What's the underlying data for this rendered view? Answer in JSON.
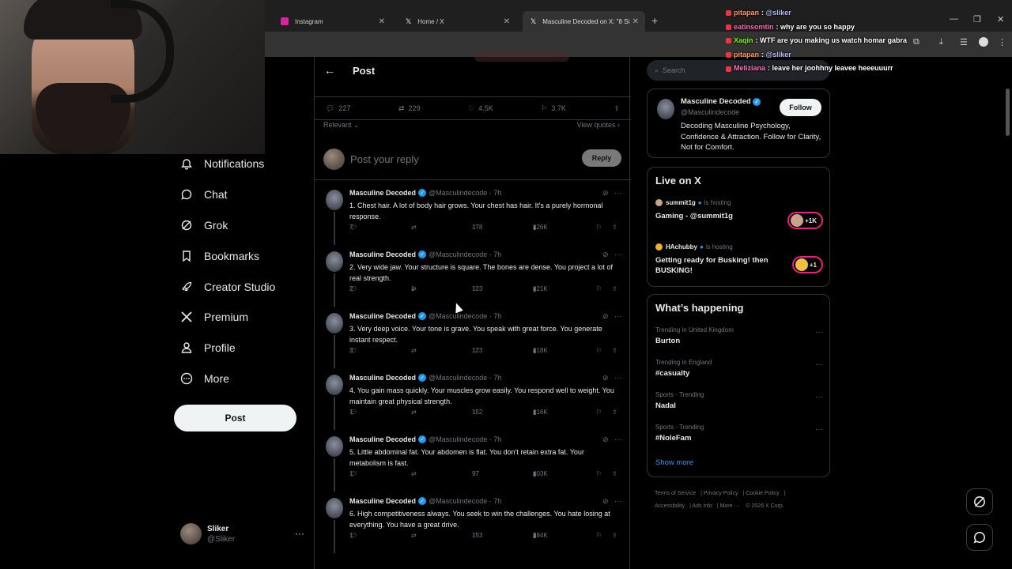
{
  "browser": {
    "tabs": [
      {
        "label": "Instagram",
        "color": "#d6249f"
      },
      {
        "label": "Home / X",
        "color": "#ffffff"
      },
      {
        "label": "Masculine Decoded on X: \"8 Si",
        "color": "#ffffff"
      }
    ]
  },
  "nav": {
    "items": [
      {
        "label": "Notifications",
        "icon": "bell-icon"
      },
      {
        "label": "Chat",
        "icon": "chat-icon"
      },
      {
        "label": "Grok",
        "icon": "grok-icon"
      },
      {
        "label": "Bookmarks",
        "icon": "bookmark-icon"
      },
      {
        "label": "Creator Studio",
        "icon": "rocket-icon"
      },
      {
        "label": "Premium",
        "icon": "x-logo-icon"
      },
      {
        "label": "Profile",
        "icon": "person-icon"
      },
      {
        "label": "More",
        "icon": "more-circle-icon"
      }
    ],
    "post_label": "Post",
    "user": {
      "name": "Sliker",
      "handle": "@Sliker"
    }
  },
  "main": {
    "title": "Post",
    "stats": {
      "replies": "227",
      "reposts": "229",
      "likes": "4.5K",
      "bookmarks": "3.7K"
    },
    "sort_label": "Relevant",
    "view_quotes": "View quotes",
    "reply_placeholder": "Post your reply",
    "reply_button": "Reply",
    "replies": [
      {
        "name": "Masculine Decoded",
        "handle": "@Masculindecode",
        "time": "7h",
        "text": "1. Chest hair. A lot of body hair grows. Your chest has hair. It's a purely hormonal response.",
        "replies": "7",
        "reposts": "",
        "likes": "178",
        "views": "426K"
      },
      {
        "name": "Masculine Decoded",
        "handle": "@Masculindecode",
        "time": "7h",
        "text": "2. Very wide jaw. Your structure is square. The bones are dense. You project a lot of real strength.",
        "replies": "2",
        "reposts": "1",
        "likes": "123",
        "views": "421K"
      },
      {
        "name": "Masculine Decoded",
        "handle": "@Masculindecode",
        "time": "7h",
        "text": "3. Very deep voice. Your tone is grave. You speak with great force. You generate instant respect.",
        "replies": "3",
        "reposts": "",
        "likes": "123",
        "views": "418K"
      },
      {
        "name": "Masculine Decoded",
        "handle": "@Masculindecode",
        "time": "7h",
        "text": "4. You gain mass quickly. Your muscles grow easily. You respond well to weight. You maintain great physical strength.",
        "replies": "1",
        "reposts": "",
        "likes": "152",
        "views": "416K"
      },
      {
        "name": "Masculine Decoded",
        "handle": "@Masculindecode",
        "time": "7h",
        "text": "5. Little abdominal fat. Your abdomen is flat. You don't retain extra fat. Your metabolism is fast.",
        "replies": "1",
        "reposts": "",
        "likes": "97",
        "views": "403K"
      },
      {
        "name": "Masculine Decoded",
        "handle": "@Masculindecode",
        "time": "7h",
        "text": "6. High competitiveness always. You seek to win the challenges. You hate losing at everything. You have a great drive.",
        "replies": "1",
        "reposts": "",
        "likes": "153",
        "views": "384K"
      }
    ]
  },
  "right": {
    "search_placeholder": "Search",
    "promo": {
      "name": "Masculine Decoded",
      "handle": "@Masculindecode",
      "follow": "Follow",
      "bio": "Decoding Masculine Psychology, Confidence & Attraction. Follow for Clarity, Not for Comfort."
    },
    "live": {
      "title": "Live on X",
      "hosting_label": "is hosting",
      "items": [
        {
          "host": "summit1g",
          "title": "Gaming - @summit1g",
          "count": "+1K"
        },
        {
          "host": "HAchubby",
          "title": "Getting ready for Busking! then BUSKING!",
          "count": "+1"
        }
      ]
    },
    "trends": {
      "title": "What’s happening",
      "items": [
        {
          "context": "Trending in United Kingdom",
          "name": "Burton"
        },
        {
          "context": "Trending in England",
          "name": "#casualty"
        },
        {
          "context": "Sports · Trending",
          "name": "Nadal"
        },
        {
          "context": "Sports · Trending",
          "name": "#NoleFam"
        }
      ],
      "show_more": "Show more"
    },
    "footer": [
      "Terms of Service",
      "Privacy Policy",
      "Cookie Policy",
      "Accessibility",
      "Ads info",
      "More ···",
      "© 2026 X Corp."
    ]
  },
  "chat": [
    {
      "user": "pitapan",
      "color": "#ff9a5c",
      "msg": "",
      "mention": "@sliker"
    },
    {
      "user": "eatinsomtin",
      "color": "#ff69b4",
      "msg": "why are you so happy",
      "mention": ""
    },
    {
      "user": "Xaqin",
      "color": "#7cfc00",
      "msg": "WTF are you making us watch homar gabra",
      "mention": ""
    },
    {
      "user": "pitapan",
      "color": "#ff9a5c",
      "msg": "",
      "mention": "@sliker"
    },
    {
      "user": "Meliziana",
      "color": "#ff6ec7",
      "msg": "leave her joohhny leavee heeeuuurr",
      "mention": ""
    }
  ],
  "colors": {
    "accent": "#1d9bf0",
    "live": "#f91880"
  }
}
